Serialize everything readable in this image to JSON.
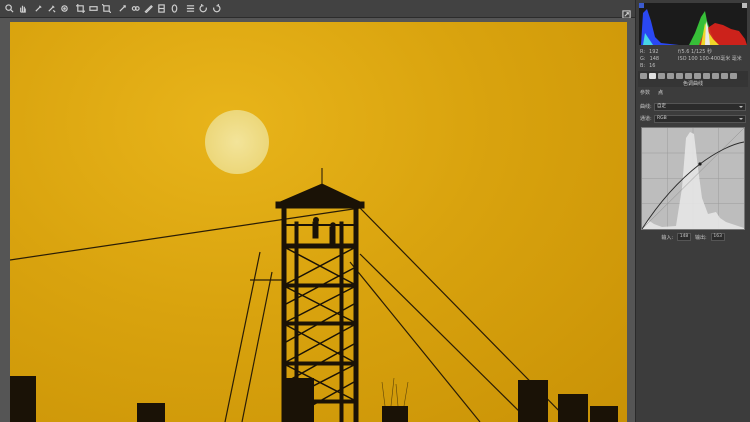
{
  "toolbar": {
    "tools": [
      "zoom-icon",
      "hand-icon",
      "white-balance-icon",
      "color-sampler-icon",
      "target-adjust-icon",
      "crop-icon",
      "straighten-icon",
      "transform-icon",
      "spot-removal-icon",
      "red-eye-icon",
      "adjustment-brush-icon",
      "graduated-filter-icon",
      "radial-filter-icon",
      "preferences-icon",
      "rotate-left-icon",
      "rotate-right-icon"
    ]
  },
  "histogram": {
    "colors": {
      "red": "#e0241c",
      "green": "#39c83a",
      "blue": "#2b4bff",
      "yellow": "#f3e82a",
      "cyan": "#48d6e6",
      "white": "#e8e8e8"
    }
  },
  "readout": {
    "r_label": "R:",
    "r_value": "192",
    "g_label": "G:",
    "g_value": "148",
    "b_label": "B:",
    "b_value": "16",
    "camera_line1": "f/5.6   1/125 秒",
    "camera_line2": "ISO 100   100-400毫米 毫米"
  },
  "panel": {
    "title": "色调曲线",
    "sub_tabs": [
      "参数",
      "点"
    ],
    "preset_label": "曲线:",
    "preset_value": "自定",
    "channel_label": "通道:",
    "channel_value": "RGB",
    "input_label": "输入:",
    "input_value": "148",
    "output_label": "输出:",
    "output_value": "163"
  },
  "photo": {
    "sky_color": "#d9a30e",
    "sun_color": "#f0df8a",
    "silhouette_color": "#1a1206"
  }
}
